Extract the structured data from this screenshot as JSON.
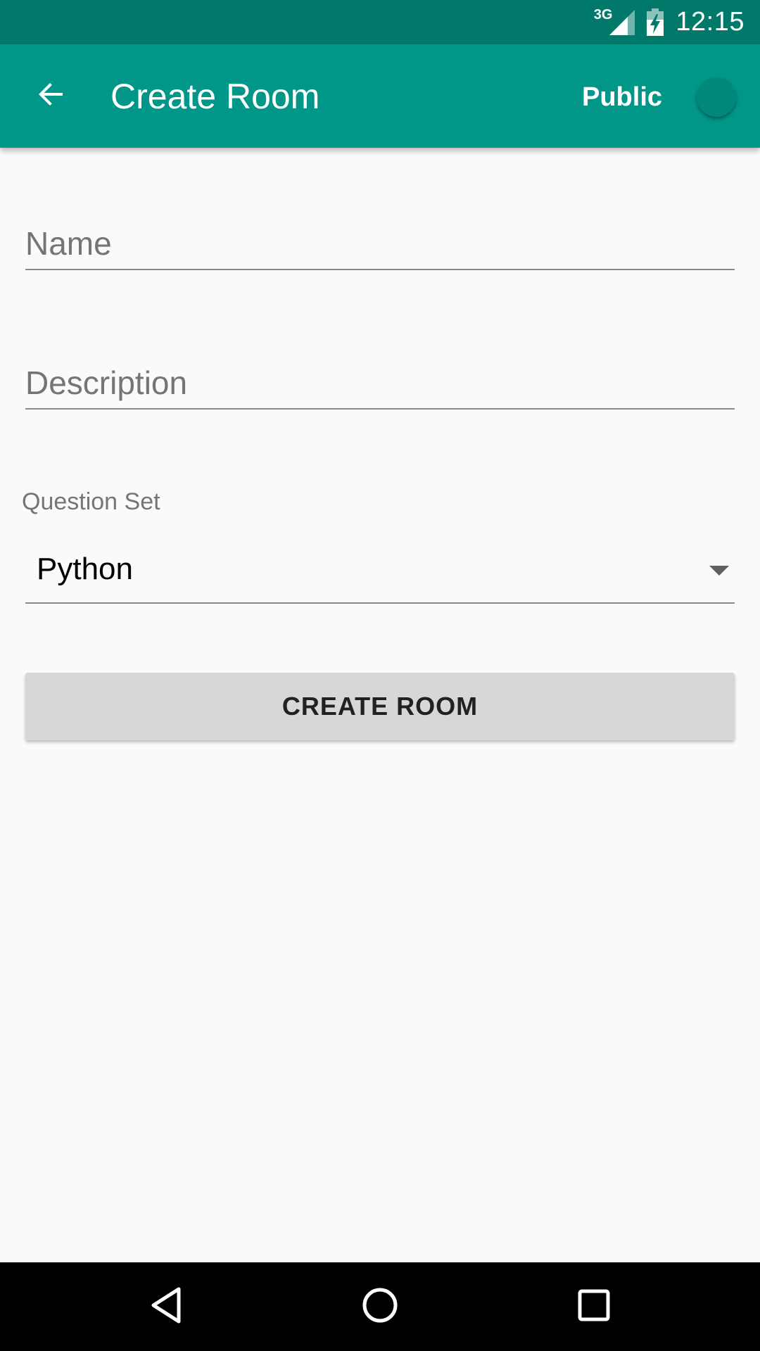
{
  "status_bar": {
    "network_type": "3G",
    "time": "12:15",
    "icons": [
      "signal-icon",
      "battery-charging-icon"
    ]
  },
  "toolbar": {
    "back_icon": "arrow-back-icon",
    "title": "Create Room",
    "public_label": "Public",
    "public_toggle_on": false
  },
  "form": {
    "name": {
      "value": "",
      "placeholder": "Name"
    },
    "description": {
      "value": "",
      "placeholder": "Description"
    },
    "question_set": {
      "label": "Question Set",
      "selected": "Python",
      "icon": "dropdown-arrow-icon"
    },
    "create_button_label": "CREATE ROOM"
  },
  "nav_bar": {
    "icons": [
      "back-triangle-icon",
      "home-circle-icon",
      "recents-square-icon"
    ]
  },
  "colors": {
    "status_bar": "#00796b",
    "toolbar": "#009688",
    "background": "#fafafa",
    "button": "#d6d7d7",
    "nav_bar": "#000000"
  }
}
